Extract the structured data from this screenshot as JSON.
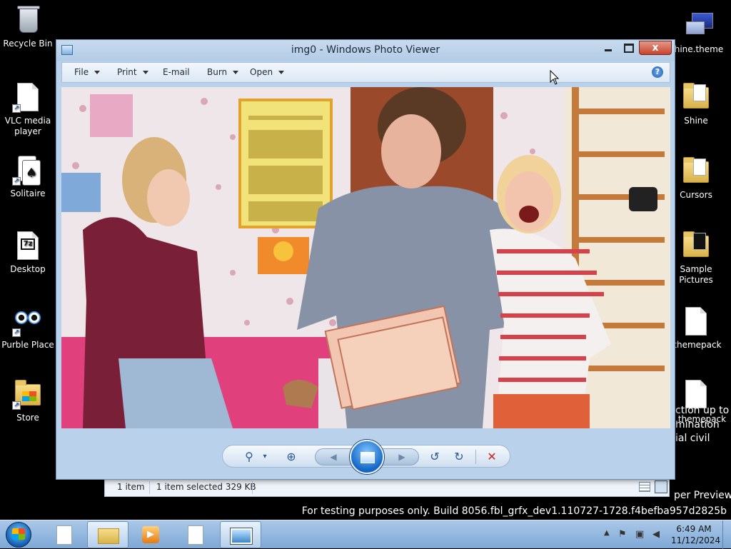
{
  "desktop": {
    "left_icons": [
      {
        "label": "Recycle Bin",
        "icon": "recycle-bin-icon"
      },
      {
        "label": "VLC media player",
        "icon": "document-icon"
      },
      {
        "label": "Solitaire",
        "icon": "solitaire-icon"
      },
      {
        "label": "Desktop",
        "icon": "7zip-icon"
      },
      {
        "label": "Purble Place",
        "icon": "purble-place-icon"
      },
      {
        "label": "Store",
        "icon": "store-folder-icon"
      }
    ],
    "right_icons": [
      {
        "label": "hine.theme",
        "icon": "theme-icon"
      },
      {
        "label": "Shine",
        "icon": "folder-icon"
      },
      {
        "label": "Cursors",
        "icon": "folder-icon"
      },
      {
        "label": "Sample Pictures",
        "icon": "folder-icon"
      },
      {
        "label": ".themepack",
        "icon": "document-icon"
      },
      {
        "label": ".themepack",
        "icon": "document-icon"
      }
    ],
    "overlap_text": {
      "line1": "ction up to",
      "line2": "mination",
      "line3": "ial civil",
      "line4": "per Preview"
    },
    "watermark": "For testing purposes only. Build 8056.fbl_grfx_dev1.110727-1728.f4befba957d2825b"
  },
  "window": {
    "title": "img0 - Windows Photo Viewer",
    "close_glyph": "x",
    "menu": {
      "file": "File",
      "print": "Print",
      "email": "E-mail",
      "burn": "Burn",
      "open": "Open"
    },
    "help_glyph": "?"
  },
  "controls": {
    "zoom_glyph": "⚲",
    "actual_size_glyph": "⊕",
    "prev_glyph": "◀",
    "next_glyph": "▶",
    "rotate_ccw_glyph": "↺",
    "rotate_cw_glyph": "↻",
    "delete_glyph": "✕"
  },
  "statusbar": {
    "count": "1 item",
    "selection": "1 item selected  329 KB"
  },
  "taskbar": {
    "time": "6:49 AM",
    "date": "11/12/2024"
  },
  "colors": {
    "window_frame": "#b9d1ea",
    "close_red": "#c8432c",
    "taskbar": "#7ea8d6",
    "delete_red": "#cc2222"
  }
}
